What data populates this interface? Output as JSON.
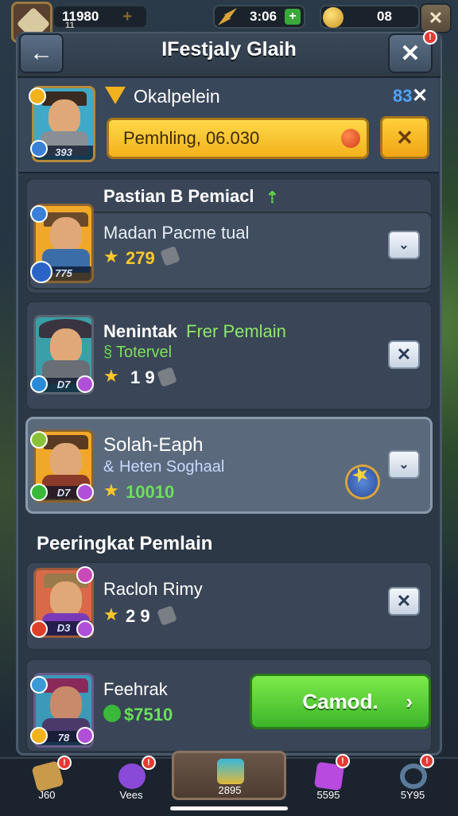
{
  "topbar": {
    "resource1": "11980",
    "resource1_sub": "11",
    "resource2": "3:06",
    "resource3": "08"
  },
  "header": {
    "title": "IFestjaly Glaih",
    "back_icon": "arrow-left-icon",
    "close_icon": "close-icon",
    "close_badge": "!"
  },
  "own": {
    "name": "Okalpelein",
    "level": "393",
    "search_text": "Pemhling, 06.030",
    "tag": "83",
    "cancel_icon": "close-icon"
  },
  "players": [
    {
      "name": "Pastian B Pemiacl",
      "sub": "Madan Pacme tual",
      "score": "279",
      "level": "775",
      "action": "chevron-down"
    },
    {
      "name": "Nenintak",
      "name_suffix": "Frer Pemlain",
      "sub": "Totervel",
      "score": "1 9",
      "level": "D7",
      "action": "close"
    },
    {
      "name": "Solah-Eaph",
      "sub": "Heten Soghaal",
      "score": "10010",
      "level": "D7",
      "action": "chevron-down"
    },
    {
      "name": "Racloh Rimy",
      "sub": "",
      "score": "2 9",
      "level": "D3",
      "action": "close"
    },
    {
      "name": "Feehrak",
      "sub": "",
      "score": "$7510",
      "level": "78",
      "action": "play"
    }
  ],
  "section_title": "Peeringkat Pemlain",
  "command_button": "Camod.",
  "nav": [
    {
      "label": "J60",
      "icon": "quill-icon"
    },
    {
      "label": "Vees",
      "icon": "potion-icon"
    },
    {
      "label": "2895",
      "icon": "chest-icon"
    },
    {
      "label": "5595",
      "icon": "gem-icon"
    },
    {
      "label": "5Y95",
      "icon": "ring-icon"
    }
  ],
  "colors": {
    "accent_yellow": "#f2b21c",
    "accent_green": "#3cb52a",
    "star_gold": "#ffc928",
    "badge_red": "#e53935"
  }
}
